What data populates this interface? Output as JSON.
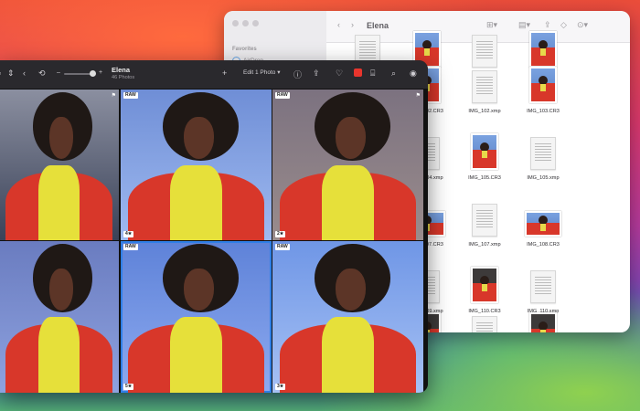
{
  "colors": {
    "accent": "#2f7fe6",
    "flag": "#e8352d"
  },
  "finder": {
    "title": "Elena",
    "sidebar_heading": "Favorites",
    "sidebar_items": [
      {
        "label": "AirDrop",
        "icon": "airdrop-icon"
      }
    ],
    "files": [
      {
        "name": "",
        "kind": "doc"
      },
      {
        "name": "",
        "kind": "photo-p"
      },
      {
        "name": "",
        "kind": "doc"
      },
      {
        "name": "",
        "kind": "photo-p"
      },
      {
        "name": "",
        "kind": "hidden"
      },
      {
        "name": "IMG_102.CR3",
        "kind": "photo-p"
      },
      {
        "name": "IMG_102.xmp",
        "kind": "doc"
      },
      {
        "name": "IMG_103.CR3",
        "kind": "photo-p"
      },
      {
        "name": "",
        "kind": "hidden"
      },
      {
        "name": "IMG_104.xmp",
        "kind": "doc"
      },
      {
        "name": "IMG_105.CR3",
        "kind": "photo-p"
      },
      {
        "name": "IMG_105.xmp",
        "kind": "doc"
      },
      {
        "name": "",
        "kind": "hidden"
      },
      {
        "name": "IMG_107.CR3",
        "kind": "photo-l"
      },
      {
        "name": "IMG_107.xmp",
        "kind": "doc"
      },
      {
        "name": "IMG_108.CR3",
        "kind": "photo-l"
      },
      {
        "name": "",
        "kind": "hidden"
      },
      {
        "name": "IMG_109.xmp",
        "kind": "doc"
      },
      {
        "name": "IMG_110.CR3",
        "kind": "photo-d"
      },
      {
        "name": "IMG_110.xmp",
        "kind": "doc"
      },
      {
        "name": "",
        "kind": "hidden"
      },
      {
        "name": "",
        "kind": "photo-d"
      },
      {
        "name": "",
        "kind": "doc"
      },
      {
        "name": "",
        "kind": "photo-d"
      }
    ],
    "partial_names": [
      "xmp",
      "CR3",
      "CR3",
      "CR3",
      "CR3"
    ]
  },
  "photos": {
    "album_title": "Elena",
    "album_subtitle": "46 Photos",
    "edit_label": "Edit 1 Photo",
    "tiles": [
      {
        "raw": "",
        "flag": "⚑",
        "rating": ""
      },
      {
        "raw": "RAW",
        "flag": "",
        "rating": "4★"
      },
      {
        "raw": "RAW",
        "flag": "⚑",
        "rating": "2★"
      },
      {
        "raw": "",
        "flag": "",
        "rating": ""
      },
      {
        "raw": "RAW",
        "flag": "",
        "rating": "5★"
      },
      {
        "raw": "RAW",
        "flag": "",
        "rating": "3★"
      }
    ]
  }
}
